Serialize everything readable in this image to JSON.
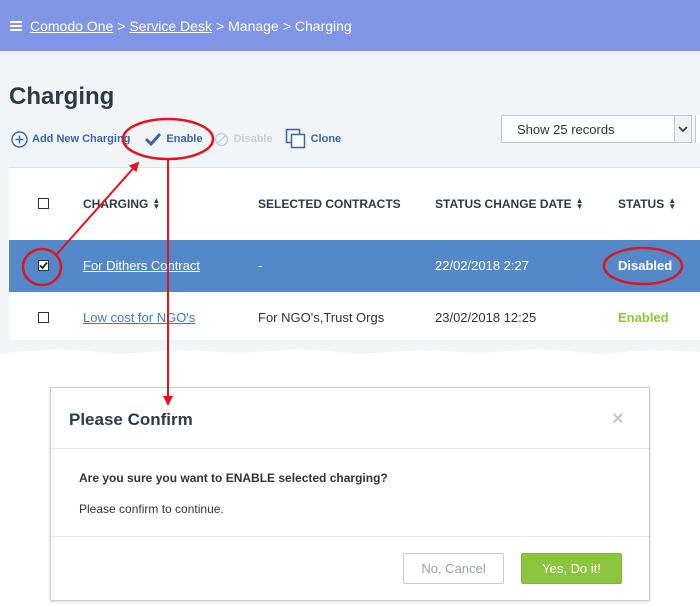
{
  "topbar": {
    "breadcrumb": [
      "Comodo One",
      "Service Desk",
      "Manage",
      "Charging"
    ],
    "separator": ">"
  },
  "page": {
    "title": "Charging"
  },
  "toolbar": {
    "add_label": "Add New Charging",
    "enable_label": "Enable",
    "disable_label": "Disable",
    "clone_label": "Clone"
  },
  "records_select": {
    "value": "Show 25 records"
  },
  "table": {
    "columns": [
      "CHARGING",
      "SELECTED CONTRACTS",
      "STATUS CHANGE DATE",
      "STATUS"
    ],
    "rows": [
      {
        "name": "For Dithers Contract",
        "contracts": "-",
        "date": "22/02/2018 2:27",
        "status": "Disabled",
        "checked": true
      },
      {
        "name": "Low cost for NGO's",
        "contracts": "For NGO's,Trust Orgs",
        "date": "23/02/2018 12:25",
        "status": "Enabled",
        "checked": false
      }
    ]
  },
  "modal": {
    "title": "Please Confirm",
    "close": "×",
    "question": "Are you sure you want to ENABLE selected charging?",
    "subtext": "Please confirm to continue.",
    "cancel_label": "No, Cancel",
    "confirm_label": "Yes, Do it!"
  },
  "colors": {
    "topbar": "#8095e5",
    "selected_row": "#5588c8",
    "enabled_status": "#8cc63f",
    "annotation": "#e0141e",
    "confirm_button": "#8cc63f"
  }
}
